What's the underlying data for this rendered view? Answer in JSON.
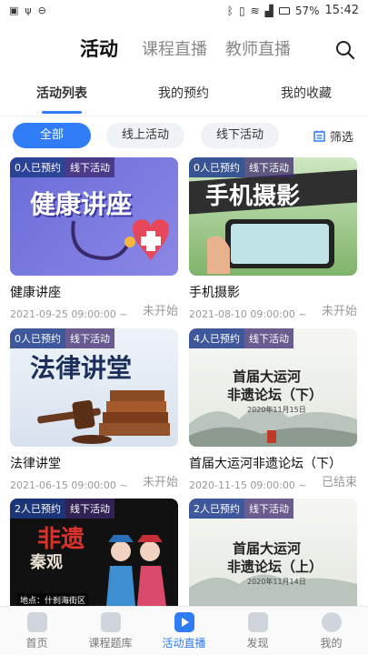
{
  "status_bar": {
    "battery": "57%",
    "time": "15:42"
  },
  "top_tabs": [
    {
      "label": "活动",
      "active": true
    },
    {
      "label": "课程直播",
      "active": false
    },
    {
      "label": "教师直播",
      "active": false
    }
  ],
  "sub_tabs": [
    {
      "label": "活动列表",
      "active": true
    },
    {
      "label": "我的预约",
      "active": false
    },
    {
      "label": "我的收藏",
      "active": false
    }
  ],
  "filters": {
    "chips": [
      {
        "label": "全部",
        "active": true
      },
      {
        "label": "线上活动",
        "active": false
      },
      {
        "label": "线下活动",
        "active": false
      }
    ],
    "filter_label": "筛选"
  },
  "cards": [
    {
      "booked": "0人已预约",
      "type": "线下活动",
      "title": "健康讲座",
      "date": "2021-09-25 09:00:00 ~",
      "status": "未开始",
      "art": "健康讲座"
    },
    {
      "booked": "0人已预约",
      "type": "线下活动",
      "title": "手机摄影",
      "date": "2021-08-10 09:00:00 ~",
      "status": "未开始",
      "art": "手机摄影"
    },
    {
      "booked": "0人已预约",
      "type": "线下活动",
      "title": "法律讲堂",
      "date": "2021-06-15 09:00:00 ~",
      "status": "未开始",
      "art": "法律讲堂"
    },
    {
      "booked": "4人已预约",
      "type": "线下活动",
      "title": "首届大运河非遗论坛（下）",
      "date": "2020-11-15 09:00:00 ~",
      "status": "已结束",
      "art_lines": [
        "首届大运河",
        "非遗论坛（下）"
      ],
      "art_date": "2020年11月15日"
    },
    {
      "booked": "2人已预约",
      "type": "线下活动",
      "title": "",
      "date": "",
      "status": "",
      "art": "非遗",
      "art_sub": "秦观",
      "art_caption": "地点：什刹海街区"
    },
    {
      "booked": "2人已预约",
      "type": "线下活动",
      "title": "",
      "date": "",
      "status": "",
      "art_lines": [
        "首届大运河",
        "非遗论坛（上）"
      ],
      "art_date": "2020年11月14日"
    }
  ],
  "bottom_nav": [
    {
      "label": "首页",
      "active": false
    },
    {
      "label": "课程题库",
      "active": false
    },
    {
      "label": "活动直播",
      "active": true
    },
    {
      "label": "发现",
      "active": false
    },
    {
      "label": "我的",
      "active": false
    }
  ]
}
